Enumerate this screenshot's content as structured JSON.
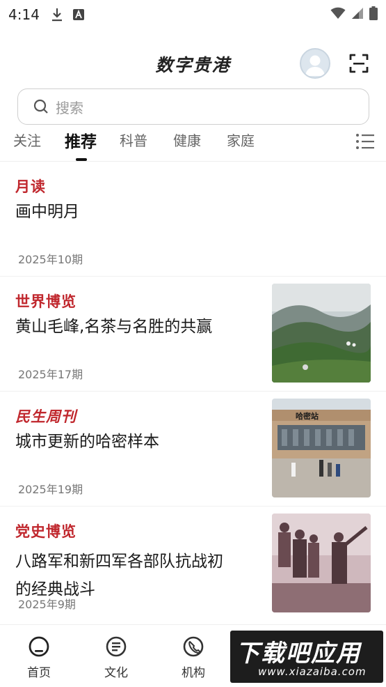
{
  "status_bar": {
    "time": "4:14"
  },
  "header": {
    "title": "数字贵港"
  },
  "search": {
    "placeholder": "搜索"
  },
  "tabs": [
    {
      "label": "关注"
    },
    {
      "label": "推荐",
      "active": true
    },
    {
      "label": "科普"
    },
    {
      "label": "健康"
    },
    {
      "label": "家庭"
    }
  ],
  "feed": [
    {
      "magazine": "月读",
      "title": "画中明月",
      "issue": "2025年10期"
    },
    {
      "magazine": "世界博览",
      "title": "黄山毛峰,名茶与名胜的共赢",
      "issue": "2025年17期"
    },
    {
      "magazine": "民生周刊",
      "title": "城市更新的哈密样本",
      "issue": "2025年19期",
      "sign_text": "哈密站"
    },
    {
      "magazine": "党史博览",
      "title_line1": "八路军和新四军各部队抗战初",
      "title_line2": "的经典战斗",
      "issue": "2025年9期"
    }
  ],
  "bottom_nav": [
    {
      "label": "首页",
      "icon": "home-icon"
    },
    {
      "label": "文化",
      "icon": "culture-icon"
    },
    {
      "label": "机构",
      "icon": "phone-icon"
    }
  ],
  "watermark": {
    "main": "下载吧应用",
    "url": "www.xiazaiba.com"
  },
  "colors": {
    "accent_red": "#c0272d",
    "text_dark": "#1a1a1a",
    "text_muted": "#777777"
  }
}
